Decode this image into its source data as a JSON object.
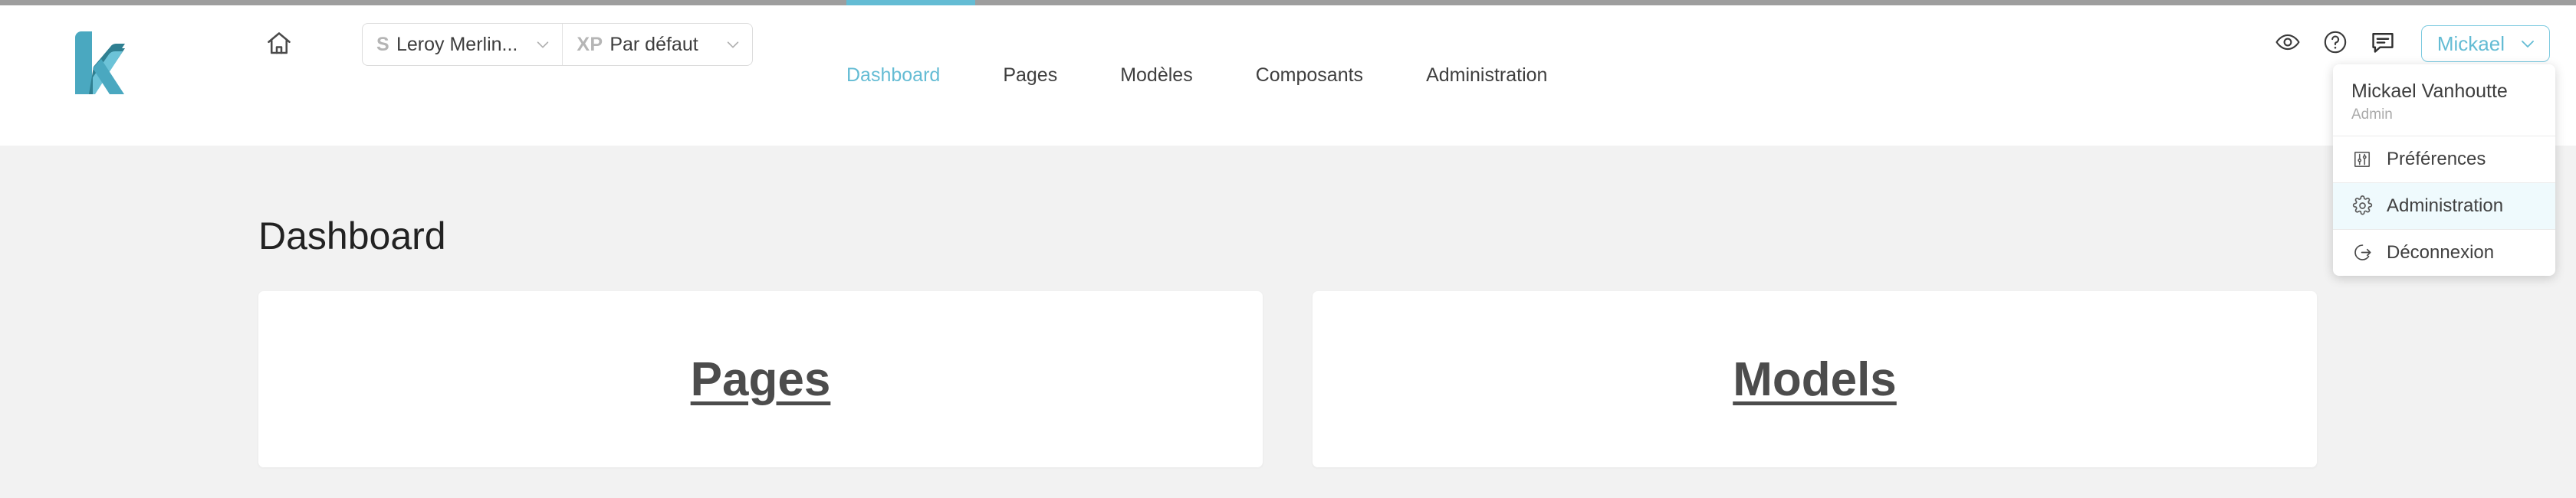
{
  "theme": {
    "accent": "#64bcd4",
    "page_bg": "#f2f2f2",
    "header_bg": "#ffffff",
    "text": "#3f3f3f",
    "muted": "#aaaaaa",
    "highlight_bg": "#effafd"
  },
  "header": {
    "logo_alt": "k",
    "home_icon": "home-icon",
    "selectors": [
      {
        "badge": "S",
        "label": "Leroy Merlin...",
        "caret": "chevron-down-icon"
      },
      {
        "badge": "XP",
        "label": "Par défaut",
        "caret": "chevron-down-icon"
      }
    ],
    "nav": [
      {
        "label": "Dashboard",
        "active": true
      },
      {
        "label": "Pages",
        "active": false
      },
      {
        "label": "Modèles",
        "active": false
      },
      {
        "label": "Composants",
        "active": false
      },
      {
        "label": "Administration",
        "active": false
      }
    ],
    "icons": [
      {
        "name": "eye-icon"
      },
      {
        "name": "help-circle-icon"
      },
      {
        "name": "comment-icon"
      }
    ],
    "user_button": {
      "label": "Mickael",
      "caret": "chevron-down-icon"
    }
  },
  "user_menu": {
    "name": "Mickael Vanhoutte",
    "role": "Admin",
    "items": [
      {
        "label": "Préférences",
        "icon": "sliders-icon",
        "highlight": false
      },
      {
        "label": "Administration",
        "icon": "gear-icon",
        "highlight": true
      },
      {
        "label": "Déconnexion",
        "icon": "logout-icon",
        "highlight": false
      }
    ]
  },
  "main": {
    "title": "Dashboard",
    "cards": [
      {
        "label": "Pages"
      },
      {
        "label": "Models"
      }
    ]
  }
}
